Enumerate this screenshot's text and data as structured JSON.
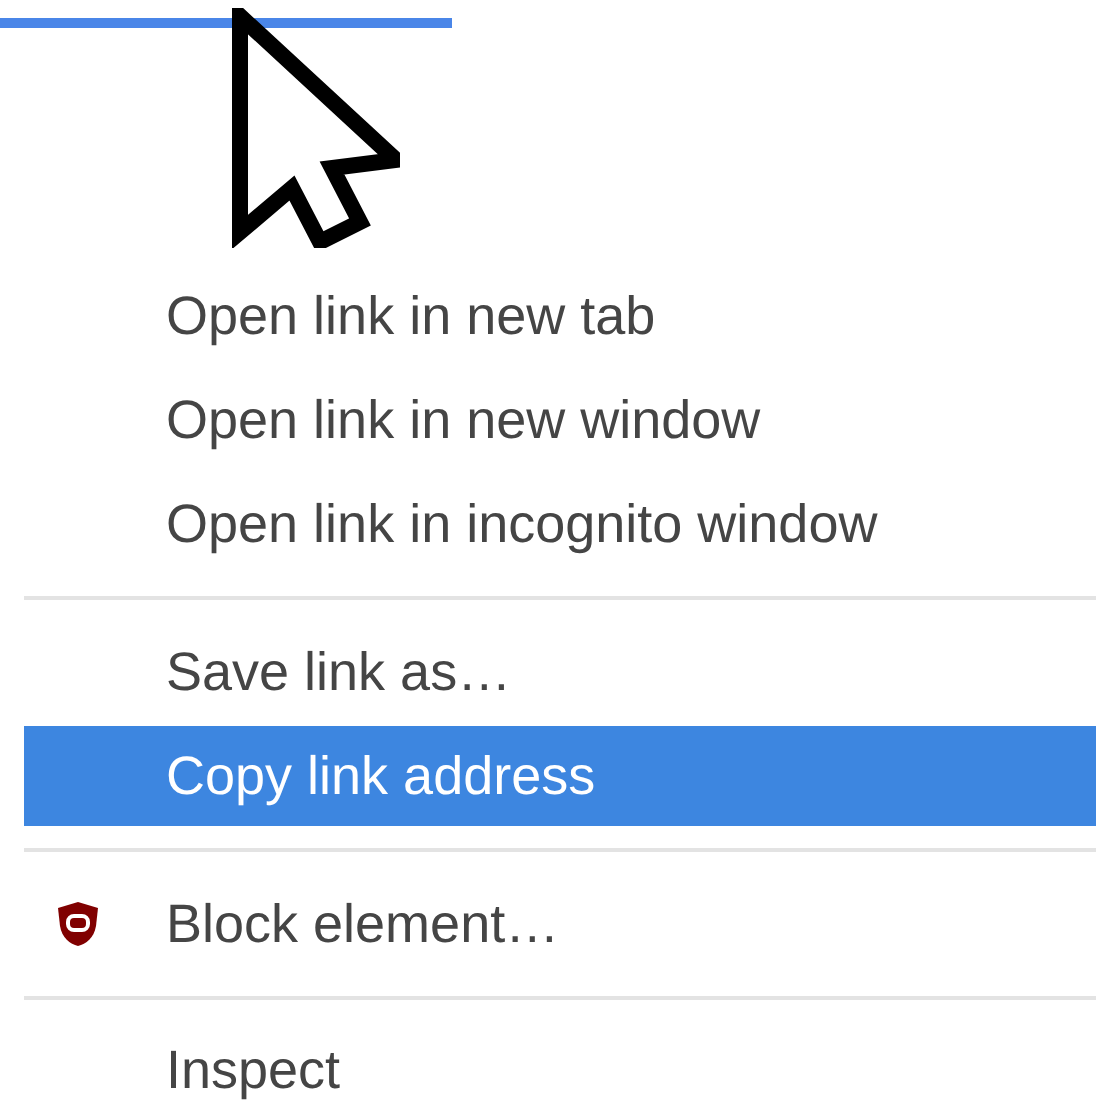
{
  "menu": {
    "items": [
      {
        "kind": "item",
        "label": "Open link in new tab",
        "selected": false
      },
      {
        "kind": "item",
        "label": "Open link in new window",
        "selected": false
      },
      {
        "kind": "item",
        "label": "Open link in incognito window",
        "selected": false
      },
      {
        "kind": "separator"
      },
      {
        "kind": "item",
        "label": "Save link as…",
        "selected": false
      },
      {
        "kind": "item",
        "label": "Copy link address",
        "selected": true
      },
      {
        "kind": "separator"
      },
      {
        "kind": "icon_item",
        "label": "Block element…",
        "selected": false
      },
      {
        "kind": "separator"
      },
      {
        "kind": "item",
        "label": "Inspect",
        "selected": false
      }
    ]
  }
}
